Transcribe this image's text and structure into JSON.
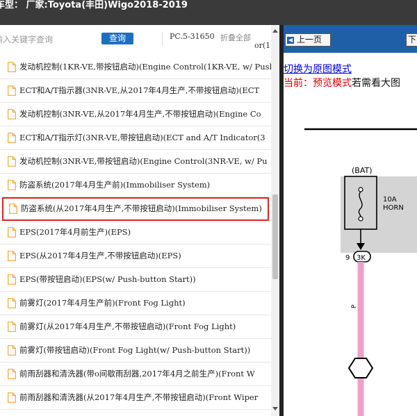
{
  "header": {
    "title": "车型：  厂家:Toyota(丰田)Wigo2018-2019"
  },
  "search": {
    "placeholder": "输入关键字查询",
    "button_label": "查询"
  },
  "toolbar": {
    "pc_code": "PC.5-31650",
    "collapse_label": "折叠全部",
    "overflow_text": "or(1"
  },
  "list": {
    "items": [
      {
        "label": "发动机控制(1KR-VE,带按钮启动)(Engine Control(1KR-VE, w/ Push"
      },
      {
        "label": "ECT和A/T指示器(3NR-VE,从2017年4月生产,不带按钮启动)(ECT"
      },
      {
        "label": "发动机控制(3NR-VE,从2017年4月生产,不带按钮启动)(Engine Co"
      },
      {
        "label": "ECT和A/T指示灯(3NR-VE,带按钮启动)(ECT and A/T Indicator(3"
      },
      {
        "label": "发动机控制(3NR-VE,带按钮启动)(Engine Control(3NR-VE, w/ Pu"
      },
      {
        "label": "防盗系统(2017年4月生产前)(Immobiliser System)"
      },
      {
        "label": "防盗系统(从2017年4月生产,不带按钮启动)(Immobiliser System)"
      },
      {
        "label": "EPS(2017年4月前生产)(EPS)"
      },
      {
        "label": "EPS(从2017年4月生产,不带按钮启动)(EPS)"
      },
      {
        "label": "EPS(带按钮启动)(EPS(w/ Push-button Start))"
      },
      {
        "label": "前雾灯(2017年4月生产前)(Front Fog Light)"
      },
      {
        "label": "前雾灯(从2017年4月生产,不带按钮启动)(Front Fog Light)"
      },
      {
        "label": "前雾灯(带按钮启动)(Front Fog Light(w/ Push-button Start))"
      },
      {
        "label": "前雨刮器和清洗器(带o间歇雨刮器,2017年4月之前生产)(Front W"
      },
      {
        "label": "前雨刮器和清洗器(从2017年4月生产,不带按钮启动)(Front Wiper"
      }
    ],
    "selected_index": 6
  },
  "viewer": {
    "prev_label": "上一页",
    "next_label": "下",
    "switch_link": "切换为原图模式",
    "mode_current": "当前：预览模式",
    "mode_hint": "若需看大图",
    "diagram": {
      "bat_label": "(BAT)",
      "fuse_amp": "10A",
      "fuse_name": "HORN",
      "pin_number": "9",
      "connector": "3K",
      "wire_color": "P"
    }
  },
  "colors": {
    "titlebar_bg": "#3a3a3a",
    "nav_bg": "#1f5fa8",
    "selected_border": "#e02020",
    "wire_pink": "#f0a0c8",
    "link_blue": "#0000ee",
    "mode_red": "#e00000"
  }
}
